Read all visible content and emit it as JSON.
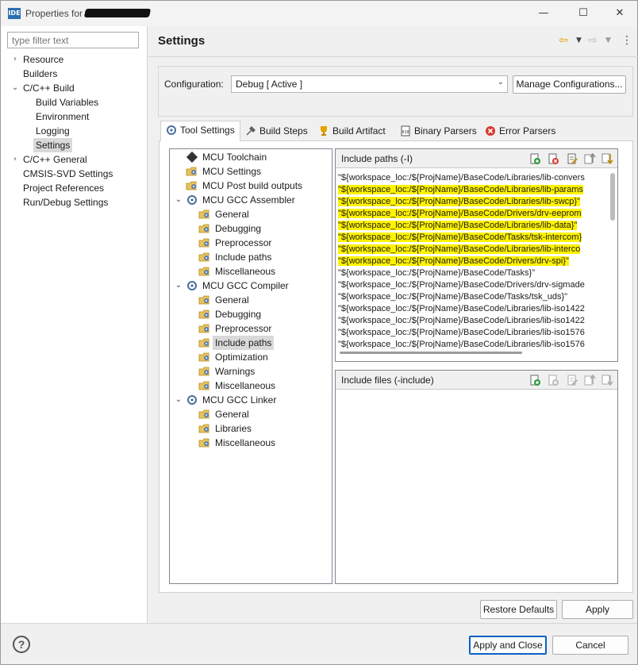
{
  "window": {
    "app_icon_text": "IDE",
    "title": "Properties for",
    "controls": {
      "minimize": "—",
      "maximize": "☐",
      "close": "✕"
    }
  },
  "sidebar": {
    "filter_placeholder": "type filter text",
    "items": [
      {
        "label": "Resource",
        "twisty": "›"
      },
      {
        "label": "Builders",
        "twisty": ""
      },
      {
        "label": "C/C++ Build",
        "twisty": "⌄"
      },
      {
        "label": "Build Variables",
        "twisty": ""
      },
      {
        "label": "Environment",
        "twisty": ""
      },
      {
        "label": "Logging",
        "twisty": ""
      },
      {
        "label": "Settings",
        "twisty": "",
        "selected": true
      },
      {
        "label": "C/C++ General",
        "twisty": "›"
      },
      {
        "label": "CMSIS-SVD Settings",
        "twisty": ""
      },
      {
        "label": "Project References",
        "twisty": ""
      },
      {
        "label": "Run/Debug Settings",
        "twisty": ""
      }
    ]
  },
  "header": {
    "title": "Settings",
    "nav_icons": [
      "back-arrow-icon",
      "dropdown-icon",
      "forward-arrow-icon",
      "dropdown-icon",
      "menu-icon"
    ]
  },
  "configuration": {
    "label": "Configuration:",
    "value": "Debug  [ Active ]",
    "manage_button": "Manage Configurations..."
  },
  "tabs": [
    {
      "label": "Tool Settings",
      "icon": "tool-settings-icon",
      "active": true
    },
    {
      "label": "Build Steps",
      "icon": "build-steps-icon"
    },
    {
      "label": "Build Artifact",
      "icon": "build-artifact-icon"
    },
    {
      "label": "Binary Parsers",
      "icon": "binary-parsers-icon"
    },
    {
      "label": "Error Parsers",
      "icon": "error-parsers-icon"
    }
  ],
  "tool_tree": [
    {
      "label": "MCU Toolchain",
      "level": 0,
      "icon": "chip-icon"
    },
    {
      "label": "MCU Settings",
      "level": 0,
      "icon": "settings-folder-icon"
    },
    {
      "label": "MCU Post build outputs",
      "level": 0,
      "icon": "settings-folder-icon"
    },
    {
      "label": "MCU GCC Assembler",
      "level": 0,
      "icon": "tool-gear-icon",
      "expanded": true
    },
    {
      "label": "General",
      "level": 1,
      "icon": "settings-folder-icon"
    },
    {
      "label": "Debugging",
      "level": 1,
      "icon": "settings-folder-icon"
    },
    {
      "label": "Preprocessor",
      "level": 1,
      "icon": "settings-folder-icon"
    },
    {
      "label": "Include paths",
      "level": 1,
      "icon": "settings-folder-icon"
    },
    {
      "label": "Miscellaneous",
      "level": 1,
      "icon": "settings-folder-icon"
    },
    {
      "label": "MCU GCC Compiler",
      "level": 0,
      "icon": "tool-gear-icon",
      "expanded": true
    },
    {
      "label": "General",
      "level": 1,
      "icon": "settings-folder-icon"
    },
    {
      "label": "Debugging",
      "level": 1,
      "icon": "settings-folder-icon"
    },
    {
      "label": "Preprocessor",
      "level": 1,
      "icon": "settings-folder-icon"
    },
    {
      "label": "Include paths",
      "level": 1,
      "icon": "settings-folder-icon",
      "selected": true
    },
    {
      "label": "Optimization",
      "level": 1,
      "icon": "settings-folder-icon"
    },
    {
      "label": "Warnings",
      "level": 1,
      "icon": "settings-folder-icon"
    },
    {
      "label": "Miscellaneous",
      "level": 1,
      "icon": "settings-folder-icon"
    },
    {
      "label": "MCU GCC Linker",
      "level": 0,
      "icon": "tool-gear-icon",
      "expanded": true
    },
    {
      "label": "General",
      "level": 1,
      "icon": "settings-folder-icon"
    },
    {
      "label": "Libraries",
      "level": 1,
      "icon": "settings-folder-icon"
    },
    {
      "label": "Miscellaneous",
      "level": 1,
      "icon": "settings-folder-icon"
    }
  ],
  "include_paths": {
    "title": "Include paths (-I)",
    "toolbar_icons": [
      "add-icon",
      "delete-icon",
      "edit-icon",
      "move-up-icon",
      "move-down-icon"
    ],
    "rows": [
      {
        "text": "\"${workspace_loc:/${ProjName}/BaseCode/Libraries/lib-convers",
        "highlight": false
      },
      {
        "text": "\"${workspace_loc:/${ProjName}/BaseCode/Libraries/lib-params",
        "highlight": true
      },
      {
        "text": "\"${workspace_loc:/${ProjName}/BaseCode/Libraries/lib-swcp}\"",
        "highlight": true
      },
      {
        "text": "\"${workspace_loc:/${ProjName}/BaseCode/Drivers/drv-eeprom",
        "highlight": true
      },
      {
        "text": "\"${workspace_loc:/${ProjName}/BaseCode/Libraries/lib-data}\"",
        "highlight": true
      },
      {
        "text": "\"${workspace_loc:/${ProjName}/BaseCode/Tasks/tsk-intercom}",
        "highlight": true
      },
      {
        "text": "\"${workspace_loc:/${ProjName}/BaseCode/Libraries/lib-interco",
        "highlight": true
      },
      {
        "text": "\"${workspace_loc:/${ProjName}/BaseCode/Drivers/drv-spi}\"",
        "highlight": true
      },
      {
        "text": "\"${workspace_loc:/${ProjName}/BaseCode/Tasks}\"",
        "highlight": false
      },
      {
        "text": "\"${workspace_loc:/${ProjName}/BaseCode/Drivers/drv-sigmade",
        "highlight": false
      },
      {
        "text": "\"${workspace_loc:/${ProjName}/BaseCode/Tasks/tsk_uds}\"",
        "highlight": false
      },
      {
        "text": "\"${workspace_loc:/${ProjName}/BaseCode/Libraries/lib-iso1422",
        "highlight": false
      },
      {
        "text": "\"${workspace_loc:/${ProjName}/BaseCode/Libraries/lib-iso1422",
        "highlight": false
      },
      {
        "text": "\"${workspace_loc:/${ProjName}/BaseCode/Libraries/lib-iso1576",
        "highlight": false
      },
      {
        "text": "\"${workspace_loc:/${ProjName}/BaseCode/Libraries/lib-iso1576",
        "highlight": false
      }
    ]
  },
  "include_files": {
    "title": "Include files (-include)",
    "toolbar_icons": [
      "add-icon",
      "delete-icon",
      "edit-icon",
      "move-up-icon",
      "move-down-icon"
    ]
  },
  "footer": {
    "restore_defaults": "Restore Defaults",
    "apply": "Apply",
    "apply_and_close": "Apply and Close",
    "cancel": "Cancel",
    "help": "?"
  },
  "colors": {
    "highlight": "#fff200",
    "accent": "#0b61c4",
    "selection": "#d9d9d9"
  }
}
